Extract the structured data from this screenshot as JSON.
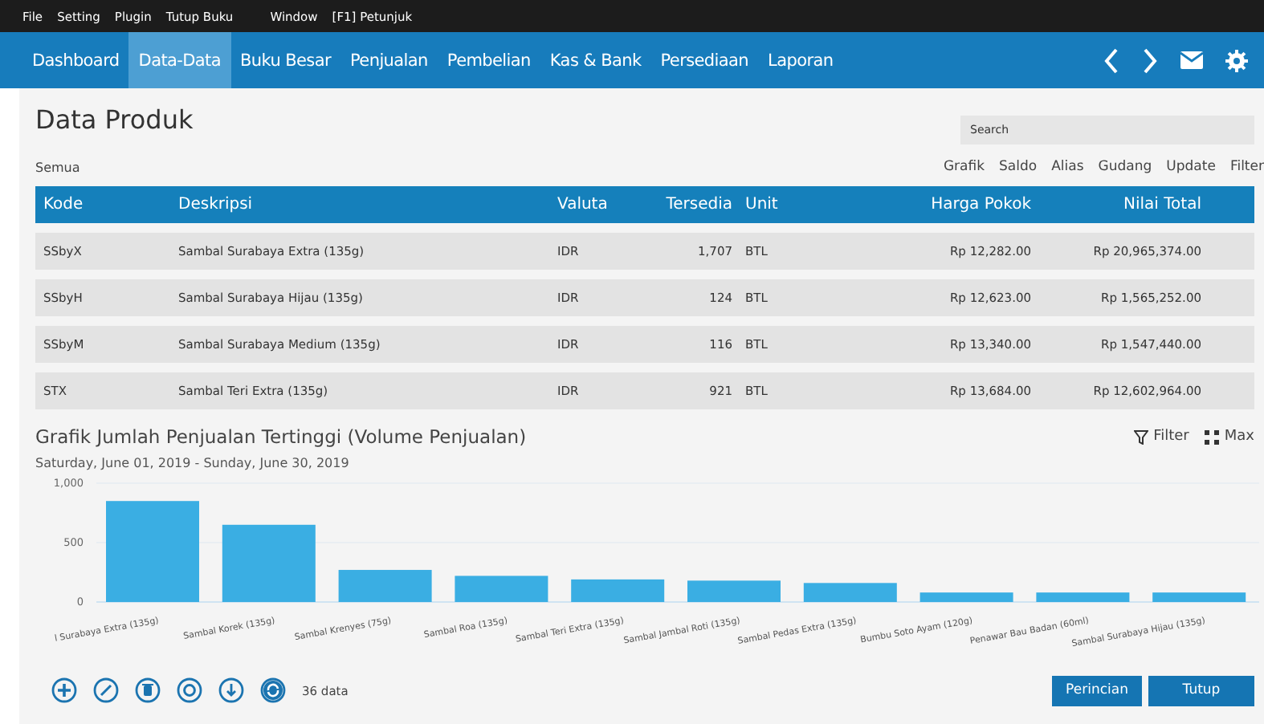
{
  "menu_bar": [
    "File",
    "Setting",
    "Plugin",
    "Tutup Buku",
    "Window",
    "[F1] Petunjuk"
  ],
  "nav_tabs": [
    {
      "label": "Dashboard",
      "selected": false
    },
    {
      "label": "Data-Data",
      "selected": true
    },
    {
      "label": "Buku Besar",
      "selected": false
    },
    {
      "label": "Penjualan",
      "selected": false
    },
    {
      "label": "Pembelian",
      "selected": false
    },
    {
      "label": "Kas & Bank",
      "selected": false
    },
    {
      "label": "Persediaan",
      "selected": false
    },
    {
      "label": "Laporan",
      "selected": false
    }
  ],
  "page_title": "Data Produk",
  "search": {
    "placeholder": "Search"
  },
  "filter_label": "Semua",
  "toolbar_links": [
    "Grafik",
    "Saldo",
    "Alias",
    "Gudang",
    "Update",
    "Filter"
  ],
  "table": {
    "columns": [
      "Kode",
      "Deskripsi",
      "Valuta",
      "Tersedia",
      "Unit",
      "Harga Pokok",
      "Nilai Total"
    ],
    "rows": [
      [
        "SSbyX",
        "Sambal Surabaya Extra (135g)",
        "IDR",
        "1,707",
        "BTL",
        "Rp 12,282.00",
        "Rp 20,965,374.00"
      ],
      [
        "SSbyH",
        "Sambal Surabaya Hijau (135g)",
        "IDR",
        "124",
        "BTL",
        "Rp 12,623.00",
        "Rp 1,565,252.00"
      ],
      [
        "SSbyM",
        "Sambal Surabaya Medium (135g)",
        "IDR",
        "116",
        "BTL",
        "Rp 13,340.00",
        "Rp 1,547,440.00"
      ],
      [
        "STX",
        "Sambal Teri Extra (135g)",
        "IDR",
        "921",
        "BTL",
        "Rp 13,684.00",
        "Rp 12,602,964.00"
      ]
    ]
  },
  "chart_panel": {
    "subtitle": "Saturday, June 01, 2019 - Sunday, June 30, 2019",
    "actions": [
      "Filter",
      "Max"
    ],
    "chart_data": {
      "type": "bar",
      "title": "Grafik Jumlah Penjualan Tertinggi (Volume Penjualan)",
      "categories": [
        "l Surabaya Extra (135g)",
        "Sambal Korek (135g)",
        "Sambal Krenyes (75g)",
        "Sambal Roa (135g)",
        "Sambal Teri Extra (135g)",
        "Sambal Jambal Roti (135g)",
        "Sambal Pedas Extra (135g)",
        "Bumbu Soto Ayam (120g)",
        "Penawar Bau Badan (60ml)",
        "Sambal Surabaya Hijau (135g)"
      ],
      "values": [
        850,
        650,
        270,
        220,
        190,
        180,
        160,
        80,
        80,
        80
      ],
      "ylim": [
        0,
        1000
      ],
      "yticks": [
        0,
        500,
        {
          "value": 1000,
          "label": "1,000"
        }
      ]
    }
  },
  "footer": {
    "tools": [
      {
        "kind": "add"
      },
      {
        "kind": "edit"
      },
      {
        "kind": "delete"
      },
      {
        "kind": "refresh"
      },
      {
        "kind": "download"
      },
      {
        "kind": "sync"
      }
    ],
    "count": "36 data",
    "buttons": [
      "Perincian",
      "Tutup"
    ]
  }
}
